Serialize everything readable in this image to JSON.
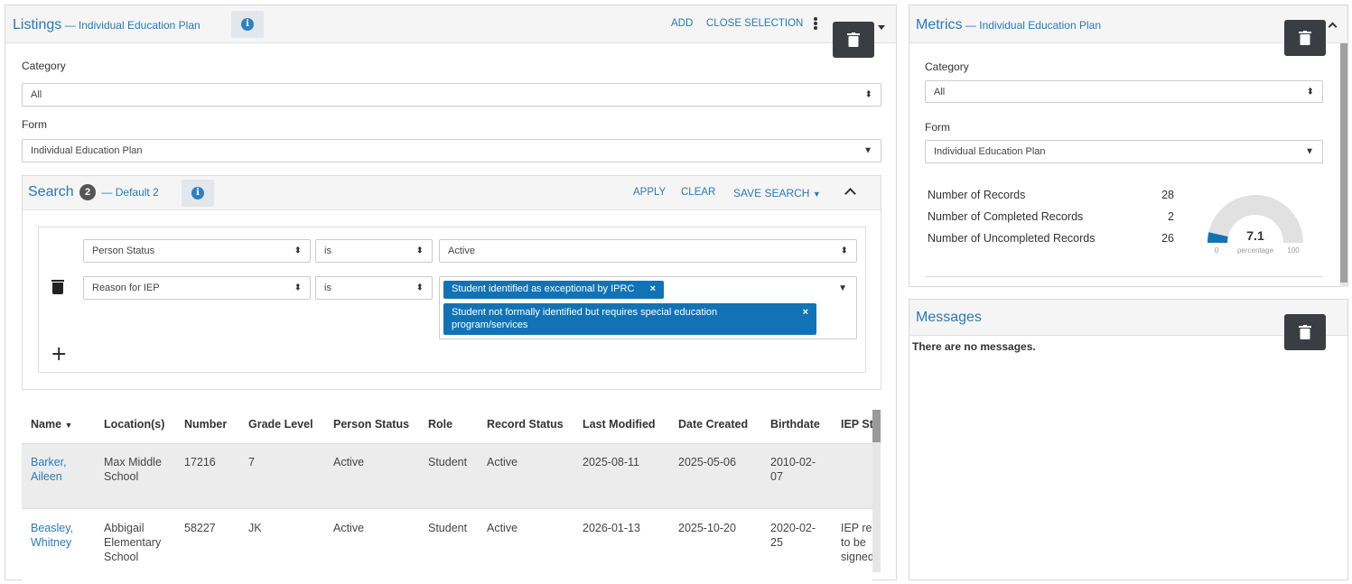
{
  "listings": {
    "title": "Listings",
    "subtitle": "— Individual Education Plan",
    "add_label": "ADD",
    "close_label": "CLOSE SELECTION",
    "category_label": "Category",
    "category_value": "All",
    "form_label": "Form",
    "form_value": "Individual Education Plan"
  },
  "search": {
    "title": "Search",
    "count": "2",
    "subtitle": "— Default 2",
    "apply_label": "APPLY",
    "clear_label": "CLEAR",
    "save_label": "SAVE SEARCH",
    "rows": [
      {
        "field": "Person Status",
        "op": "is",
        "value": "Active"
      },
      {
        "field": "Reason for IEP",
        "op": "is"
      }
    ],
    "tags": [
      "Student identified as exceptional by IPRC",
      "Student not formally identified but requires special education program/services"
    ],
    "add_symbol": "+"
  },
  "table": {
    "headers": [
      "Name",
      "Location(s)",
      "Number",
      "Grade Level",
      "Person Status",
      "Role",
      "Record Status",
      "Last Modified",
      "Date Created",
      "Birthdate",
      "IEP St"
    ],
    "rows": [
      [
        "Barker, Aileen",
        "Max Middle School",
        "17216",
        "7",
        "Active",
        "Student",
        "Active",
        "2025-08-11",
        "2025-05-06",
        "2010-02-07",
        ""
      ],
      [
        "Beasley, Whitney",
        "Abbigail Elementary School",
        "58227",
        "JK",
        "Active",
        "Student",
        "Active",
        "2026-01-13",
        "2025-10-20",
        "2020-02-25",
        "IEP re to be signed"
      ]
    ]
  },
  "metrics": {
    "title": "Metrics",
    "subtitle": "— Individual Education Plan",
    "category_label": "Category",
    "category_value": "All",
    "form_label": "Form",
    "form_value": "Individual Education Plan",
    "items": [
      {
        "label": "Number of Records",
        "value": "28"
      },
      {
        "label": "Number of Completed Records",
        "value": "2"
      },
      {
        "label": "Number of Uncompleted Records",
        "value": "26"
      }
    ],
    "gauge": {
      "value": "7.1",
      "fraction": 0.071,
      "min": "0",
      "max": "100",
      "caption": "percentage"
    }
  },
  "messages": {
    "title": "Messages",
    "empty": "There are no messages."
  },
  "colors": {
    "accent": "#2a7ab8",
    "tag": "#1173b6",
    "dark_button": "#3a3d42"
  }
}
